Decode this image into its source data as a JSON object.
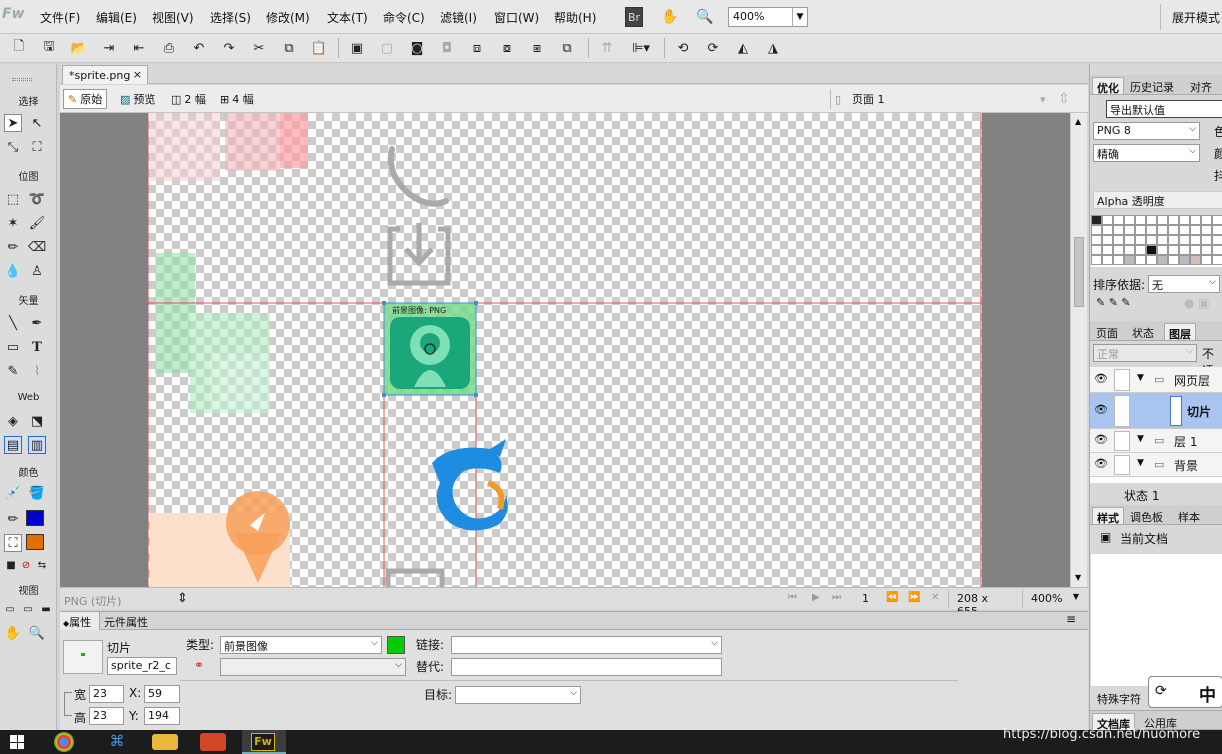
{
  "app": {
    "logo": "Fw"
  },
  "menu": [
    "文件(F)",
    "编辑(E)",
    "视图(V)",
    "选择(S)",
    "修改(M)",
    "文本(T)",
    "命令(C)",
    "滤镜(I)",
    "窗口(W)",
    "帮助(H)"
  ],
  "menubar": {
    "br_label": "Br",
    "zoom_value": "400%",
    "expand_label": "展开模式"
  },
  "tools_panel": {
    "sections": {
      "select": "选择",
      "bitmap": "位图",
      "vector": "矢量",
      "web": "Web",
      "colors": "颜色",
      "view": "视图"
    },
    "stroke_color": "#0000cc",
    "fill_color": "#e07000"
  },
  "document": {
    "tab_name": "*sprite.png",
    "tab_close": "×",
    "views": {
      "original": "原始",
      "preview": "预览",
      "two_up": "2 幅",
      "four_up": "4 幅"
    },
    "page_label": "页面 1"
  },
  "canvas": {
    "slice_label": "前景图像: PNG"
  },
  "statusbar": {
    "selection_info": "PNG (切片)",
    "page_number": "1",
    "dimensions": "208 x 655",
    "zoom": "400%"
  },
  "properties": {
    "tab_properties": "属性",
    "tab_symbol": "元件属性",
    "object_type": "切片",
    "object_name": "sprite_r2_c",
    "type_label": "类型:",
    "type_value": "前景图像",
    "slice_color": "#00cc00",
    "link_label": "链接:",
    "link_value": "",
    "alt_label": "替代:",
    "alt_value": "",
    "target_label": "目标:",
    "target_value": "",
    "width_label": "宽",
    "width_value": "23",
    "height_label": "高",
    "height_value": "23",
    "x_label": "X:",
    "x_value": "59",
    "y_label": "Y:",
    "y_value": "194"
  },
  "right_panel": {
    "tabs_top": [
      "优化",
      "历史记录",
      "对齐"
    ],
    "export_defaults": "导出默认值",
    "format": "PNG 8",
    "format_side": "色",
    "palette": "精确",
    "palette_side": "颜",
    "dither_side": "抖",
    "transparency": "Alpha 透明度",
    "sort_label": "排序依据:",
    "sort_value": "无",
    "tabs_mid": [
      "页面",
      "状态",
      "图层"
    ],
    "blend_mode": "正常",
    "opacity_label": "不透",
    "layers": [
      {
        "name": "网页层",
        "expanded": true,
        "folder": true
      },
      {
        "name": "切片",
        "expanded": false,
        "folder": false,
        "selected": true
      },
      {
        "name": "层 1",
        "expanded": true,
        "folder": true
      },
      {
        "name": "背景",
        "expanded": true,
        "folder": true
      }
    ],
    "state_label": "状态 1",
    "tabs_styles": [
      "样式",
      "调色板",
      "样本"
    ],
    "current_doc": "当前文档",
    "special_chars": "特殊字符",
    "ime_label": "中",
    "tabs_bottom": [
      "文档库",
      "公用库"
    ]
  },
  "watermark": "https://blog.csdn.net/huomore"
}
